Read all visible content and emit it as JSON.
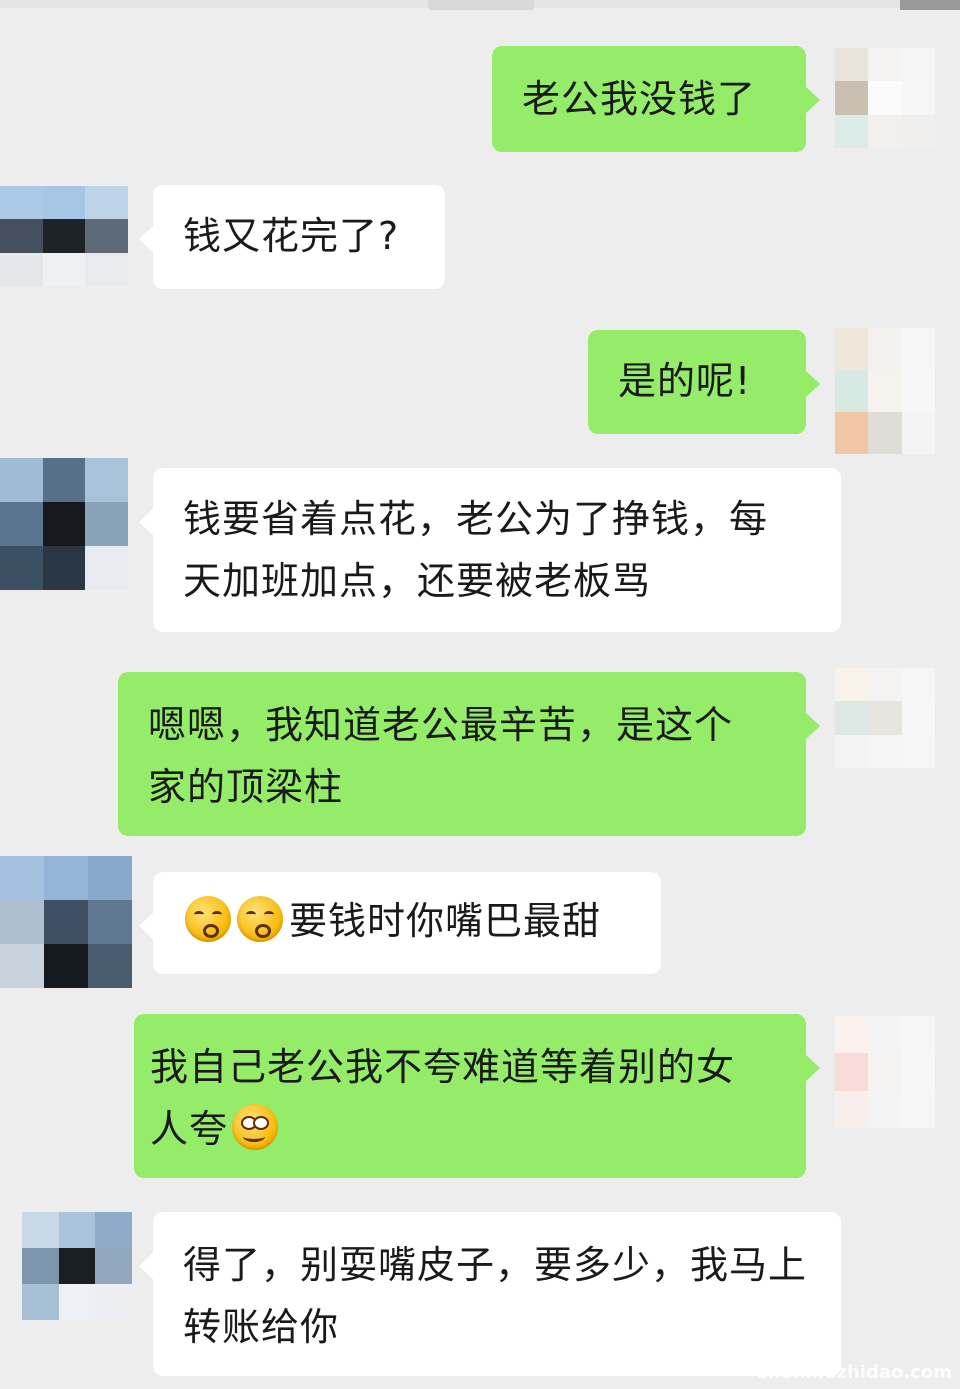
{
  "messages": [
    {
      "side": "right",
      "lines": [
        "老公我没钱了"
      ]
    },
    {
      "side": "left",
      "lines": [
        "钱又花完了?"
      ]
    },
    {
      "side": "right",
      "lines": [
        "是的呢!"
      ]
    },
    {
      "side": "left",
      "lines": [
        "钱要省着点花，老公为了挣钱，每",
        "天加班加点，还要被老板骂"
      ]
    },
    {
      "side": "right",
      "lines": [
        "嗯嗯，我知道老公最辛苦，是这个",
        "家的顶梁柱"
      ]
    },
    {
      "side": "left",
      "text": "要钱时你嘴巴最甜",
      "emoji": [
        "kiss-face",
        "kiss-face"
      ]
    },
    {
      "side": "right",
      "lines": [
        "我自己老公我不夸难道等着别的女",
        "人夸"
      ],
      "emoji_after": "smirk-face"
    },
    {
      "side": "left",
      "lines": [
        "得了，别耍嘴皮子，要多少，我马上",
        "转账给你"
      ]
    }
  ],
  "watermark": "shenmezhidao.com",
  "colors": {
    "green_bubble": "#95ec69",
    "white_bubble": "#ffffff",
    "background": "#ededed"
  }
}
